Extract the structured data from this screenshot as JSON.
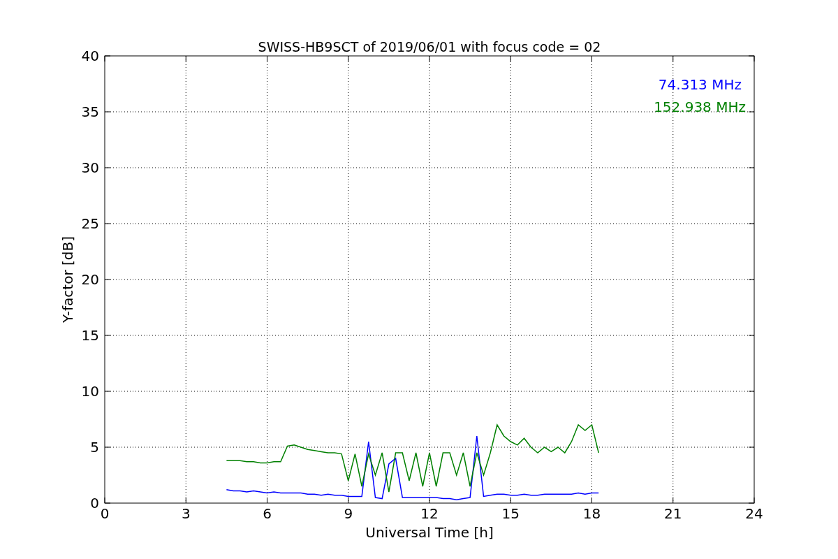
{
  "chart": {
    "chart_data": {
      "type": "line",
      "title": "SWISS-HB9SCT of 2019/06/01 with focus code = 02",
      "xlabel": "Universal Time [h]",
      "ylabel": "Y-factor [dB]",
      "x": [
        4.5,
        4.75,
        5,
        5.25,
        5.5,
        5.75,
        6,
        6.25,
        6.5,
        6.75,
        7,
        7.25,
        7.5,
        7.75,
        8,
        8.25,
        8.5,
        8.75,
        9,
        9.25,
        9.5,
        9.75,
        10,
        10.25,
        10.5,
        10.75,
        11,
        11.25,
        11.5,
        11.75,
        12,
        12.25,
        12.5,
        12.75,
        13,
        13.25,
        13.5,
        13.75,
        14,
        14.25,
        14.5,
        14.75,
        15,
        15.25,
        15.5,
        15.75,
        16,
        16.25,
        16.5,
        16.75,
        17,
        17.25,
        17.5,
        17.75,
        18,
        18.25
      ],
      "series": [
        {
          "name": "74.313 MHz",
          "color": "#0000ff",
          "values": [
            1.2,
            1.1,
            1.1,
            1.0,
            1.1,
            1.0,
            0.9,
            1.0,
            0.9,
            0.9,
            0.9,
            0.9,
            0.8,
            0.8,
            0.7,
            0.8,
            0.7,
            0.7,
            0.6,
            0.6,
            0.6,
            5.5,
            0.5,
            0.4,
            3.5,
            4,
            0.5,
            0.5,
            0.5,
            0.5,
            0.5,
            0.5,
            0.4,
            0.4,
            0.3,
            0.4,
            0.5,
            6,
            0.6,
            0.7,
            0.8,
            0.8,
            0.7,
            0.7,
            0.8,
            0.7,
            0.7,
            0.8,
            0.8,
            0.8,
            0.8,
            0.8,
            0.9,
            0.8,
            0.9,
            0.9
          ]
        },
        {
          "name": "152.938 MHz",
          "color": "#008000",
          "values": [
            3.8,
            3.8,
            3.8,
            3.7,
            3.7,
            3.6,
            3.6,
            3.7,
            3.7,
            5.1,
            5.2,
            5.0,
            4.8,
            4.7,
            4.6,
            4.5,
            4.5,
            4.4,
            2.0,
            4.4,
            1.5,
            4.4,
            2.5,
            4.5,
            1.0,
            4.5,
            4.5,
            2.0,
            4.5,
            1.5,
            4.5,
            1.5,
            4.5,
            4.5,
            2.5,
            4.5,
            1.5,
            4.5,
            2.5,
            4.5,
            7.0,
            6.0,
            5.5,
            5.2,
            5.8,
            5.0,
            4.5,
            5.0,
            4.6,
            5.0,
            4.5,
            5.5,
            7.0,
            6.5,
            7.0,
            4.5
          ]
        }
      ],
      "xlim": [
        0,
        24
      ],
      "ylim": [
        0,
        40
      ],
      "xticks": [
        0,
        3,
        6,
        9,
        12,
        15,
        18,
        21,
        24
      ],
      "yticks": [
        0,
        5,
        10,
        15,
        20,
        25,
        30,
        35,
        40
      ],
      "grid": true
    }
  }
}
